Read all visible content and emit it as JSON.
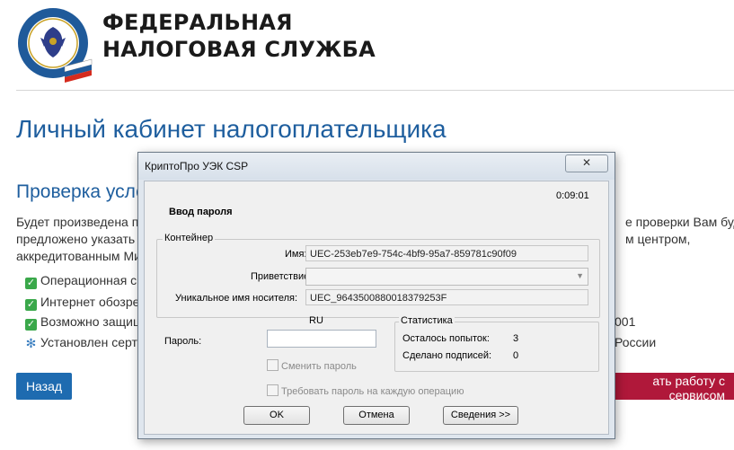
{
  "header": {
    "org_line1": "ФЕДЕРАЛЬНАЯ",
    "org_line2": "НАЛОГОВАЯ СЛУЖБА",
    "logo_icon": "fns-emblem-icon",
    "logo_ring_text": "ФЕДЕРАЛЬНАЯ НАЛОГОВАЯ СЛУЖБА"
  },
  "page": {
    "title": "Личный кабинет налогоплательщика",
    "section_title": "Проверка услов",
    "intro_left": [
      "Будет произведена про",
      "предложено указать (вь",
      "аккредитованным Мин"
    ],
    "intro_right": [
      "е проверки Вам будет",
      "м центром,"
    ],
    "checks": [
      {
        "icon": "green-check-icon",
        "text": "Операционная сист",
        "tail": ""
      },
      {
        "icon": "green-check-icon",
        "text": "Интернет обозрева",
        "tail": ""
      },
      {
        "icon": "green-check-icon",
        "text": "Возможно защище",
        "tail": "001"
      },
      {
        "icon": "spinner-icon",
        "text": "Установлен сертиф",
        "tail": "России"
      }
    ],
    "back_button": "Назад",
    "start_button": "ать работу с сервисом"
  },
  "dialog": {
    "title": "КриптоПро УЭК CSP",
    "close_glyph": "✕",
    "timer": "0:09:01",
    "heading": "Ввод пароля",
    "container_group": "Контейнер",
    "name_label": "Имя:",
    "name_value": "UEC-253eb7e9-754c-4bf9-95a7-859781c90f09",
    "greeting_label": "Приветствие:",
    "greeting_value": "",
    "carrier_label": "Уникальное имя носителя:",
    "carrier_value": "UEC_9643500880018379253F",
    "lang": "RU",
    "password_label": "Пароль:",
    "password_value": "",
    "stats_group": "Статистика",
    "attempts_label": "Осталось попыток:",
    "attempts_value": "3",
    "signatures_label": "Сделано подписей:",
    "signatures_value": "0",
    "change_password": "Сменить пароль",
    "require_password": "Требовать пароль на каждую операцию",
    "ok_button": "OK",
    "cancel_button": "Отмена",
    "details_button": "Сведения >>"
  }
}
